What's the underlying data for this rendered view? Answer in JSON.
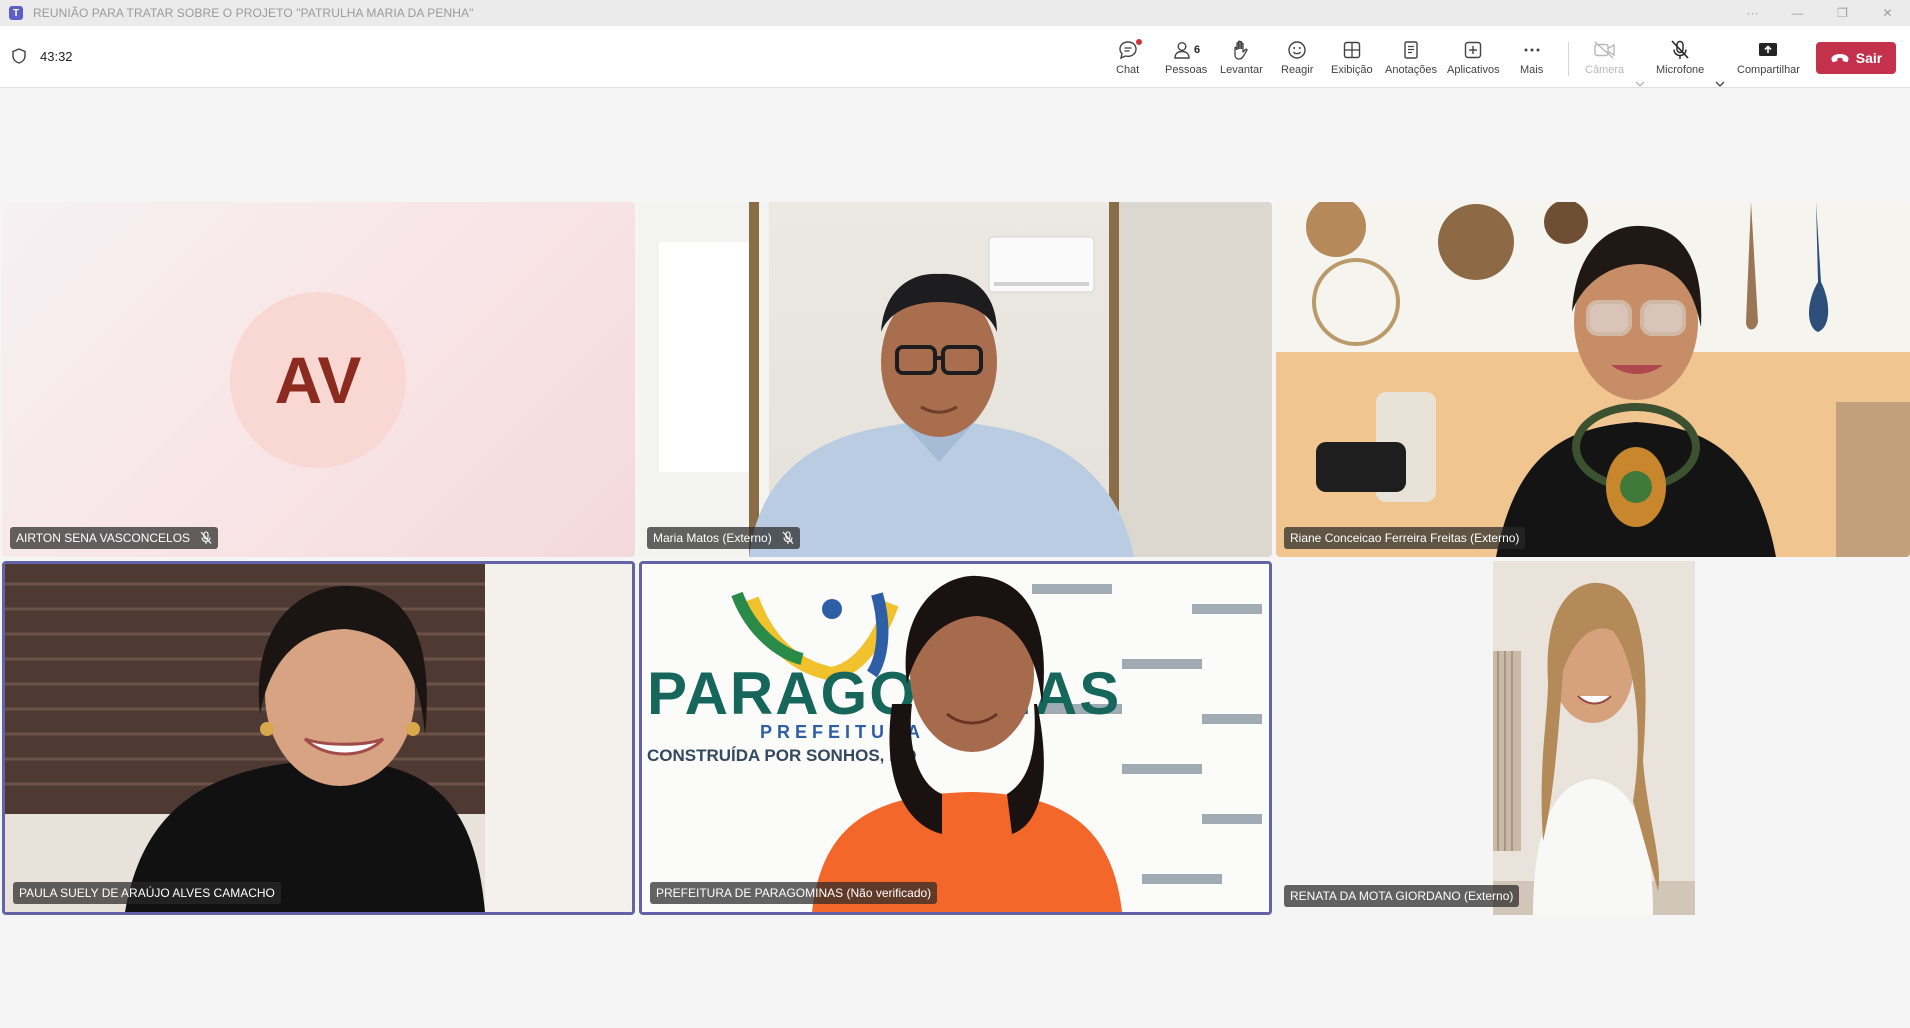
{
  "window": {
    "title": "REUNIÃO PARA TRATAR SOBRE O PROJETO \"PATRULHA MARIA DA PENHA\"",
    "app_icon": "teams-icon",
    "controls": [
      "more-icon",
      "minimize-icon",
      "restore-icon",
      "close-icon"
    ]
  },
  "toolbar": {
    "timer": "43:32",
    "chat_label": "Chat",
    "people_label": "Pessoas",
    "people_count": "6",
    "raise_label": "Levantar",
    "react_label": "Reagir",
    "view_label": "Exibição",
    "notes_label": "Anotações",
    "apps_label": "Aplicativos",
    "more_label": "Mais",
    "camera_label": "Câmera",
    "mic_label": "Microfone",
    "share_label": "Compartilhar",
    "leave_label": "Sair",
    "leave_color": "#c4314b",
    "chat_has_notification": true
  },
  "participants": [
    {
      "name": "AIRTON SENA VASCONCELOS",
      "initials": "AV",
      "muted": true,
      "video": false
    },
    {
      "name": "Maria Matos (Externo)",
      "muted": true,
      "video": true
    },
    {
      "name": "Riane Conceicao Ferreira Freitas (Externo)",
      "muted": false,
      "video": true
    },
    {
      "name": "PAULA SUELY DE ARAÚJO ALVES CAMACHO",
      "muted": false,
      "video": true,
      "active_speaker": true
    },
    {
      "name": "PREFEITURA DE PARAGOMINAS (Não verificado)",
      "muted": false,
      "video": true,
      "active_speaker": true,
      "background_text": {
        "brand": "PARAGOMINAS",
        "sub": "PREFEITURA",
        "tagline": "CONSTRUÍDA POR SONHOS, MO"
      }
    },
    {
      "name": "RENATA DA MOTA GIORDANO (Externo)",
      "muted": false,
      "video": true
    }
  ],
  "colors": {
    "accent": "#6264a7",
    "avatar_bg": "#f9d8d3",
    "avatar_fg": "#8b2a1f"
  }
}
